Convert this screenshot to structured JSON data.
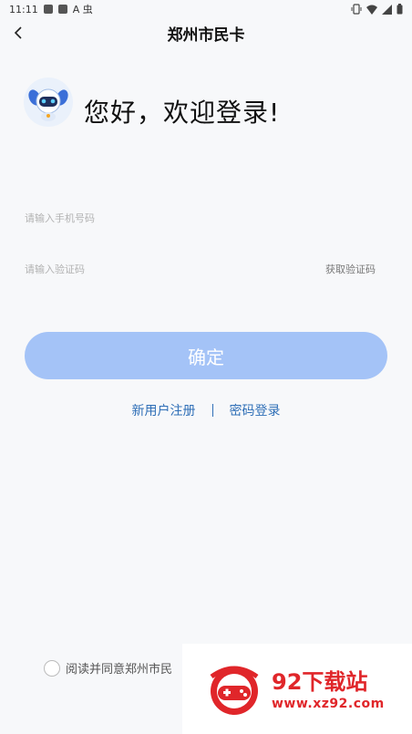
{
  "status_bar": {
    "time": "11:11",
    "extra": "A  虫"
  },
  "nav": {
    "title": "郑州市民卡"
  },
  "greeting": {
    "text": "您好，欢迎登录!"
  },
  "phone_field": {
    "placeholder": "请输入手机号码",
    "value": ""
  },
  "code_field": {
    "placeholder": "请输入验证码",
    "value": "",
    "get_code_label": "获取验证码"
  },
  "confirm_button": {
    "label": "确定",
    "color": "#a4c3f7"
  },
  "links": {
    "register": "新用户注册",
    "password_login": "密码登录"
  },
  "agreement": {
    "text": "阅读并同意郑州市民"
  },
  "watermark": {
    "brand": "92下载站",
    "url": "www.xz92.com",
    "color": "#e0262a"
  }
}
